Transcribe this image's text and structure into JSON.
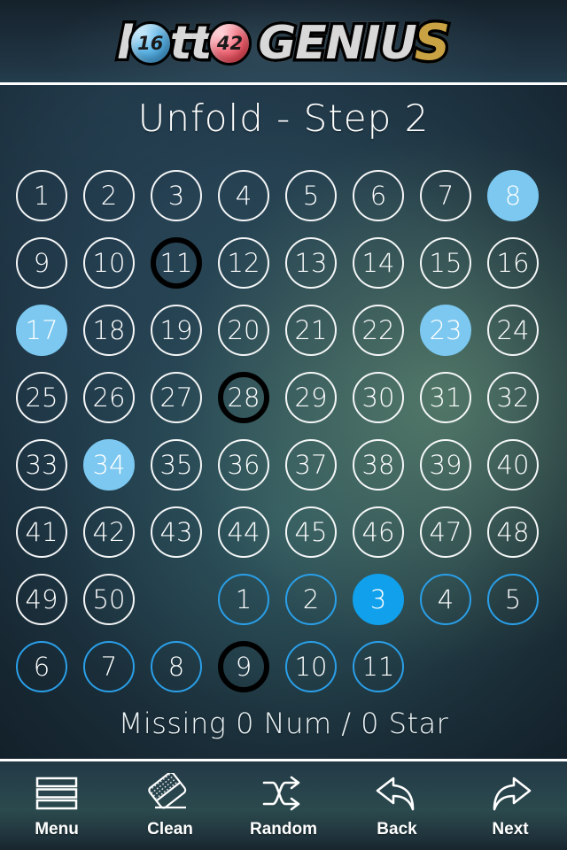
{
  "app": {
    "logo": {
      "part1": "l",
      "ball1": "16",
      "part2": "tt",
      "ball2": "42",
      "part3": "GENIU",
      "part4": "S",
      "ball1_color": "#5fb7e8",
      "ball2_color": "#e32433",
      "s_color": "#c9a243"
    }
  },
  "header": {
    "title": "Unfold - Step 2"
  },
  "colors": {
    "number_selected": "#7cc8f0",
    "star_selected": "#10a0ec",
    "star_ring": "#2a9fe8",
    "number_ring": "#ffffff",
    "marked_ring": "#000000"
  },
  "grid": {
    "rows": [
      [
        {
          "label": "1",
          "kind": "num",
          "state": "normal",
          "col": 0
        },
        {
          "label": "2",
          "kind": "num",
          "state": "normal",
          "col": 1
        },
        {
          "label": "3",
          "kind": "num",
          "state": "normal",
          "col": 2
        },
        {
          "label": "4",
          "kind": "num",
          "state": "normal",
          "col": 3
        },
        {
          "label": "5",
          "kind": "num",
          "state": "normal",
          "col": 4
        },
        {
          "label": "6",
          "kind": "num",
          "state": "normal",
          "col": 5
        },
        {
          "label": "7",
          "kind": "num",
          "state": "normal",
          "col": 6
        },
        {
          "label": "8",
          "kind": "num",
          "state": "selected",
          "col": 7
        }
      ],
      [
        {
          "label": "9",
          "kind": "num",
          "state": "normal",
          "col": 0
        },
        {
          "label": "10",
          "kind": "num",
          "state": "normal",
          "col": 1
        },
        {
          "label": "11",
          "kind": "num",
          "state": "marked",
          "col": 2
        },
        {
          "label": "12",
          "kind": "num",
          "state": "normal",
          "col": 3
        },
        {
          "label": "13",
          "kind": "num",
          "state": "normal",
          "col": 4
        },
        {
          "label": "14",
          "kind": "num",
          "state": "normal",
          "col": 5
        },
        {
          "label": "15",
          "kind": "num",
          "state": "normal",
          "col": 6
        },
        {
          "label": "16",
          "kind": "num",
          "state": "normal",
          "col": 7
        }
      ],
      [
        {
          "label": "17",
          "kind": "num",
          "state": "selected",
          "col": 0
        },
        {
          "label": "18",
          "kind": "num",
          "state": "normal",
          "col": 1
        },
        {
          "label": "19",
          "kind": "num",
          "state": "normal",
          "col": 2
        },
        {
          "label": "20",
          "kind": "num",
          "state": "normal",
          "col": 3
        },
        {
          "label": "21",
          "kind": "num",
          "state": "normal",
          "col": 4
        },
        {
          "label": "22",
          "kind": "num",
          "state": "normal",
          "col": 5
        },
        {
          "label": "23",
          "kind": "num",
          "state": "selected",
          "col": 6
        },
        {
          "label": "24",
          "kind": "num",
          "state": "normal",
          "col": 7
        }
      ],
      [
        {
          "label": "25",
          "kind": "num",
          "state": "normal",
          "col": 0
        },
        {
          "label": "26",
          "kind": "num",
          "state": "normal",
          "col": 1
        },
        {
          "label": "27",
          "kind": "num",
          "state": "normal",
          "col": 2
        },
        {
          "label": "28",
          "kind": "num",
          "state": "marked",
          "col": 3
        },
        {
          "label": "29",
          "kind": "num",
          "state": "normal",
          "col": 4
        },
        {
          "label": "30",
          "kind": "num",
          "state": "normal",
          "col": 5
        },
        {
          "label": "31",
          "kind": "num",
          "state": "normal",
          "col": 6
        },
        {
          "label": "32",
          "kind": "num",
          "state": "normal",
          "col": 7
        }
      ],
      [
        {
          "label": "33",
          "kind": "num",
          "state": "normal",
          "col": 0
        },
        {
          "label": "34",
          "kind": "num",
          "state": "selected",
          "col": 1
        },
        {
          "label": "35",
          "kind": "num",
          "state": "normal",
          "col": 2
        },
        {
          "label": "36",
          "kind": "num",
          "state": "normal",
          "col": 3
        },
        {
          "label": "37",
          "kind": "num",
          "state": "normal",
          "col": 4
        },
        {
          "label": "38",
          "kind": "num",
          "state": "normal",
          "col": 5
        },
        {
          "label": "39",
          "kind": "num",
          "state": "normal",
          "col": 6
        },
        {
          "label": "40",
          "kind": "num",
          "state": "normal",
          "col": 7
        }
      ],
      [
        {
          "label": "41",
          "kind": "num",
          "state": "normal",
          "col": 0
        },
        {
          "label": "42",
          "kind": "num",
          "state": "normal",
          "col": 1
        },
        {
          "label": "43",
          "kind": "num",
          "state": "normal",
          "col": 2
        },
        {
          "label": "44",
          "kind": "num",
          "state": "normal",
          "col": 3
        },
        {
          "label": "45",
          "kind": "num",
          "state": "normal",
          "col": 4
        },
        {
          "label": "46",
          "kind": "num",
          "state": "normal",
          "col": 5
        },
        {
          "label": "47",
          "kind": "num",
          "state": "normal",
          "col": 6
        },
        {
          "label": "48",
          "kind": "num",
          "state": "normal",
          "col": 7
        }
      ],
      [
        {
          "label": "49",
          "kind": "num",
          "state": "normal",
          "col": 0
        },
        {
          "label": "50",
          "kind": "num",
          "state": "normal",
          "col": 1
        },
        {
          "label": "1",
          "kind": "star",
          "state": "normal",
          "col": 3
        },
        {
          "label": "2",
          "kind": "star",
          "state": "normal",
          "col": 4
        },
        {
          "label": "3",
          "kind": "star",
          "state": "selected",
          "col": 5
        },
        {
          "label": "4",
          "kind": "star",
          "state": "normal",
          "col": 6
        },
        {
          "label": "5",
          "kind": "star",
          "state": "normal",
          "col": 7
        }
      ],
      [
        {
          "label": "6",
          "kind": "star",
          "state": "normal",
          "col": 0
        },
        {
          "label": "7",
          "kind": "star",
          "state": "normal",
          "col": 1
        },
        {
          "label": "8",
          "kind": "star",
          "state": "normal",
          "col": 2
        },
        {
          "label": "9",
          "kind": "star",
          "state": "marked",
          "col": 3
        },
        {
          "label": "10",
          "kind": "star",
          "state": "normal",
          "col": 4
        },
        {
          "label": "11",
          "kind": "star",
          "state": "normal",
          "col": 5
        }
      ]
    ]
  },
  "status": {
    "text": "Missing 0 Num / 0 Star"
  },
  "toolbar": {
    "items": [
      {
        "label": "Menu",
        "icon": "hamburger-menu-icon"
      },
      {
        "label": "Clean",
        "icon": "eraser-icon"
      },
      {
        "label": "Random",
        "icon": "shuffle-icon"
      },
      {
        "label": "Back",
        "icon": "undo-arrow-icon"
      },
      {
        "label": "Next",
        "icon": "redo-arrow-icon"
      }
    ]
  }
}
